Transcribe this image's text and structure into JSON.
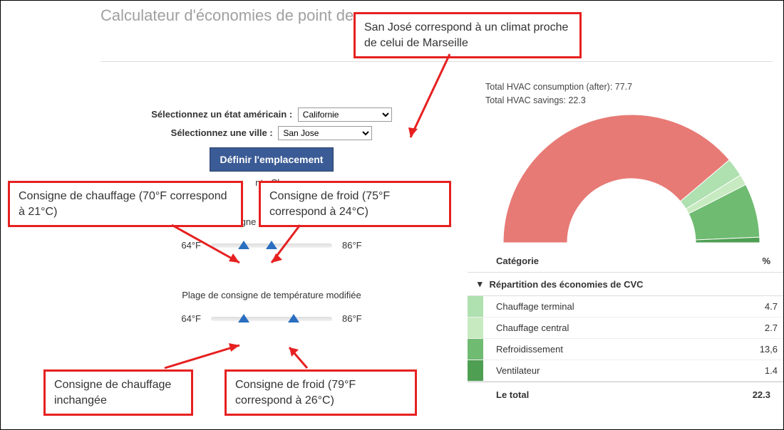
{
  "header": {
    "title": "Calculateur d'économies de point de"
  },
  "callouts": {
    "climate": "San José correspond à un climat proche de celui de Marseille",
    "heat70": "Consigne de chauffage (70°F correspond à 21°C)",
    "cool75": "Consigne de froid (75°F correspond à 24°C)",
    "heat_same": "Consigne de chauffage inchangée",
    "cool79": "Consigne de froid (79°F correspond à 26°C)"
  },
  "form": {
    "state_label": "Sélectionnez un état américain :",
    "state_value": "Californie",
    "city_label": "Sélectionnez une ville :",
    "city_value": "San Jose",
    "define_btn": "Définir l'emplacement",
    "loc_detail": "nta Clar"
  },
  "sliders": {
    "initial_title": "Plage de consigne de température de départ",
    "modified_title": "Plage de consigne de température modifiée",
    "min": "64°F",
    "max": "86°F",
    "initial_low_pct": 27,
    "initial_high_pct": 50,
    "mod_low_pct": 27,
    "mod_high_pct": 68
  },
  "stats": {
    "consumption_label": "Total HVAC consumption (after): 77.7",
    "savings_label": "Total HVAC savings: 22.3"
  },
  "chart_data": {
    "type": "pie",
    "title": "",
    "series": [
      {
        "name": "Consumption (after)",
        "value": 77.7,
        "color": "#e77a75"
      },
      {
        "name": "Chauffage terminal",
        "value": 4.7,
        "color": "#aee0b0"
      },
      {
        "name": "Chauffage central",
        "value": 2.7,
        "color": "#c7eac0"
      },
      {
        "name": "Refroidissement",
        "value": 13.6,
        "color": "#6fbb71"
      },
      {
        "name": "Ventilateur",
        "value": 1.4,
        "color": "#4e9f52"
      }
    ],
    "total": 100.1,
    "start_angle": -180,
    "inner_radius_frac": 0.5,
    "half_donut": true
  },
  "table": {
    "col_cat": "Catégorie",
    "col_pct": "%",
    "expand_label": "Répartition des économies de CVC",
    "rows": [
      {
        "label": "Chauffage terminal",
        "pct": "4.7",
        "color": "#aee0b0"
      },
      {
        "label": "Chauffage central",
        "pct": "2.7",
        "color": "#c7eac0"
      },
      {
        "label": "Refroidissement",
        "pct": "13,6",
        "color": "#6fbb71"
      },
      {
        "label": "Ventilateur",
        "pct": "1.4",
        "color": "#4e9f52"
      }
    ],
    "total_label": "Le total",
    "total_pct": "22.3"
  }
}
